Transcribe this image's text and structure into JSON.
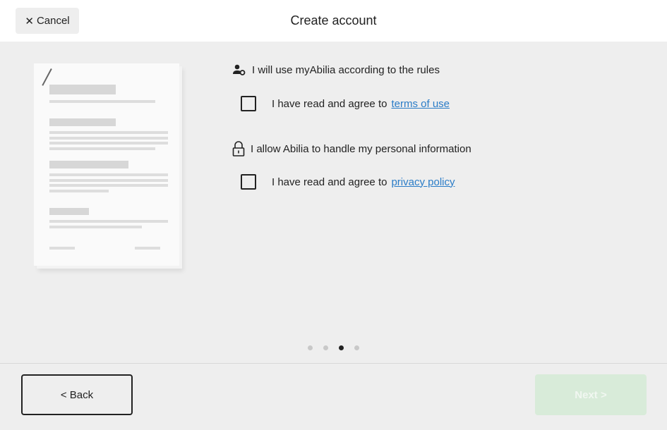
{
  "header": {
    "title": "Create account",
    "cancel_label": "Cancel",
    "cancel_icon": "close-icon"
  },
  "sections": [
    {
      "icon": "person-settings-icon",
      "heading": "I will use myAbilia according to the rules",
      "checkbox_text": "I have read and agree to",
      "link": "terms of use",
      "checked": false
    },
    {
      "icon": "lock-icon",
      "heading": "I allow Abilia to handle my personal information",
      "checkbox_text": "I have read and agree to",
      "link": "privacy policy",
      "checked": false
    }
  ],
  "pager": {
    "total": 4,
    "current": 3
  },
  "footer": {
    "back_label": "< Back",
    "next_label": "Next >",
    "next_enabled": false
  },
  "colors": {
    "link": "#2a7cc7",
    "next_disabled_bg": "#d8ebd9"
  }
}
